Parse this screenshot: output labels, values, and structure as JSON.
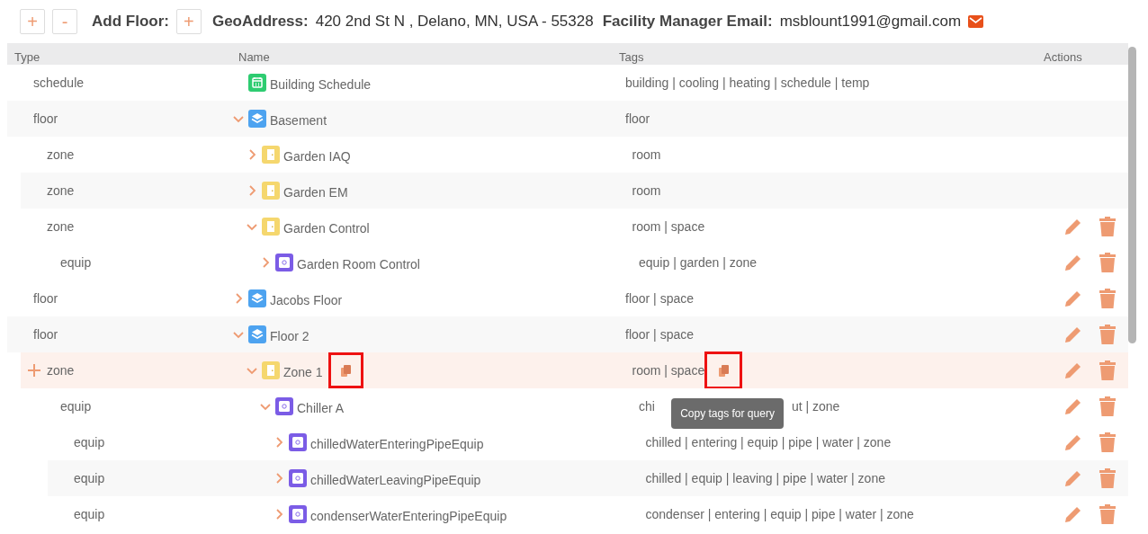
{
  "toolbar": {
    "expand_button": "+",
    "collapse_button": "-",
    "add_floor_label": "Add Floor:",
    "add_floor_button": "+",
    "geo_label": "GeoAddress:",
    "geo_value": "420 2nd St N , Delano, MN, USA - 55328",
    "email_label": "Facility Manager Email:",
    "email_value": "msblount1991@gmail.com"
  },
  "table": {
    "columns": [
      "Type",
      "Name",
      "Tags",
      "Actions"
    ],
    "rows": [
      {
        "type": "schedule",
        "kind": "schedule",
        "name": "Building Schedule",
        "tags": "building | cooling | heating | schedule | temp",
        "actions": false
      },
      {
        "type": "floor",
        "kind": "floor",
        "name": "Basement",
        "tags": "floor",
        "expanded": true,
        "actions": false,
        "children": [
          {
            "type": "zone",
            "kind": "zone",
            "name": "Garden IAQ",
            "tags": "room",
            "expanded": false,
            "actions": false
          },
          {
            "type": "zone",
            "kind": "zone",
            "name": "Garden EM",
            "tags": "room",
            "expanded": false,
            "actions": false
          },
          {
            "type": "zone",
            "kind": "zone",
            "name": "Garden Control",
            "tags": "room | space",
            "expanded": true,
            "actions": true,
            "children": [
              {
                "type": "equip",
                "kind": "equip",
                "name": "Garden Room Control",
                "tags": "equip | garden | zone",
                "expanded": false,
                "actions": true
              }
            ]
          }
        ]
      },
      {
        "type": "floor",
        "kind": "floor",
        "name": "Jacobs Floor",
        "tags": "floor | space",
        "expanded": false,
        "actions": true
      },
      {
        "type": "floor",
        "kind": "floor",
        "name": "Floor 2",
        "tags": "floor | space",
        "expanded": true,
        "actions": true,
        "children": [
          {
            "type": "zone",
            "kind": "zone",
            "name": "Zone 1",
            "tags": "room | space",
            "expanded": true,
            "actions": true,
            "hovered": true,
            "copy_highlighted": true,
            "tooltip": "Copy tags for query",
            "children": [
              {
                "type": "equip",
                "kind": "equip",
                "name": "Chiller A",
                "tags_parts": [
                  "chi",
                  "ut | zone"
                ],
                "expanded": true,
                "actions": true,
                "children": [
                  {
                    "type": "equip",
                    "kind": "equip",
                    "name": "chilledWaterEnteringPipeEquip",
                    "tags": "chilled | entering | equip | pipe | water | zone",
                    "expanded": false,
                    "actions": true
                  },
                  {
                    "type": "equip",
                    "kind": "equip",
                    "name": "chilledWaterLeavingPipeEquip",
                    "tags": "chilled | equip | leaving | pipe | water | zone",
                    "expanded": false,
                    "actions": true
                  },
                  {
                    "type": "equip",
                    "kind": "equip",
                    "name": "condenserWaterEnteringPipeEquip",
                    "tags": "condenser | entering | equip | pipe | water | zone",
                    "expanded": false,
                    "actions": true
                  }
                ]
              }
            ]
          }
        ]
      }
    ]
  }
}
